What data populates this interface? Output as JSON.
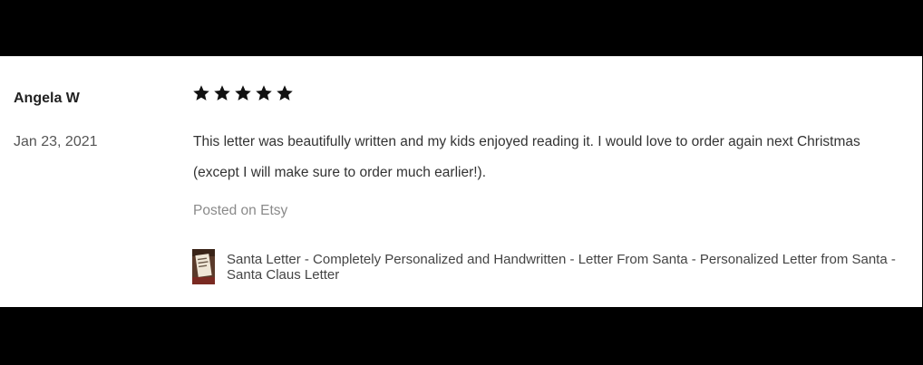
{
  "review": {
    "reviewer_name": "Angela W",
    "date": "Jan 23, 2021",
    "rating": {
      "value": 5,
      "max": 5
    },
    "text": "This letter was beautifully written and my kids enjoyed reading it. I would love to order again next Christmas (except I will make sure to order much earlier!).",
    "source": "Posted on Etsy",
    "product": {
      "title": "Santa Letter - Completely Personalized and Handwritten - Letter From Santa - Personalized Letter from Santa - Santa Claus Letter",
      "thumbnail_icon": "product-thumbnail"
    }
  },
  "colors": {
    "background_bars": "#000000",
    "card_background": "#ffffff",
    "star": "#111111",
    "muted_text": "#8a8a8a"
  }
}
